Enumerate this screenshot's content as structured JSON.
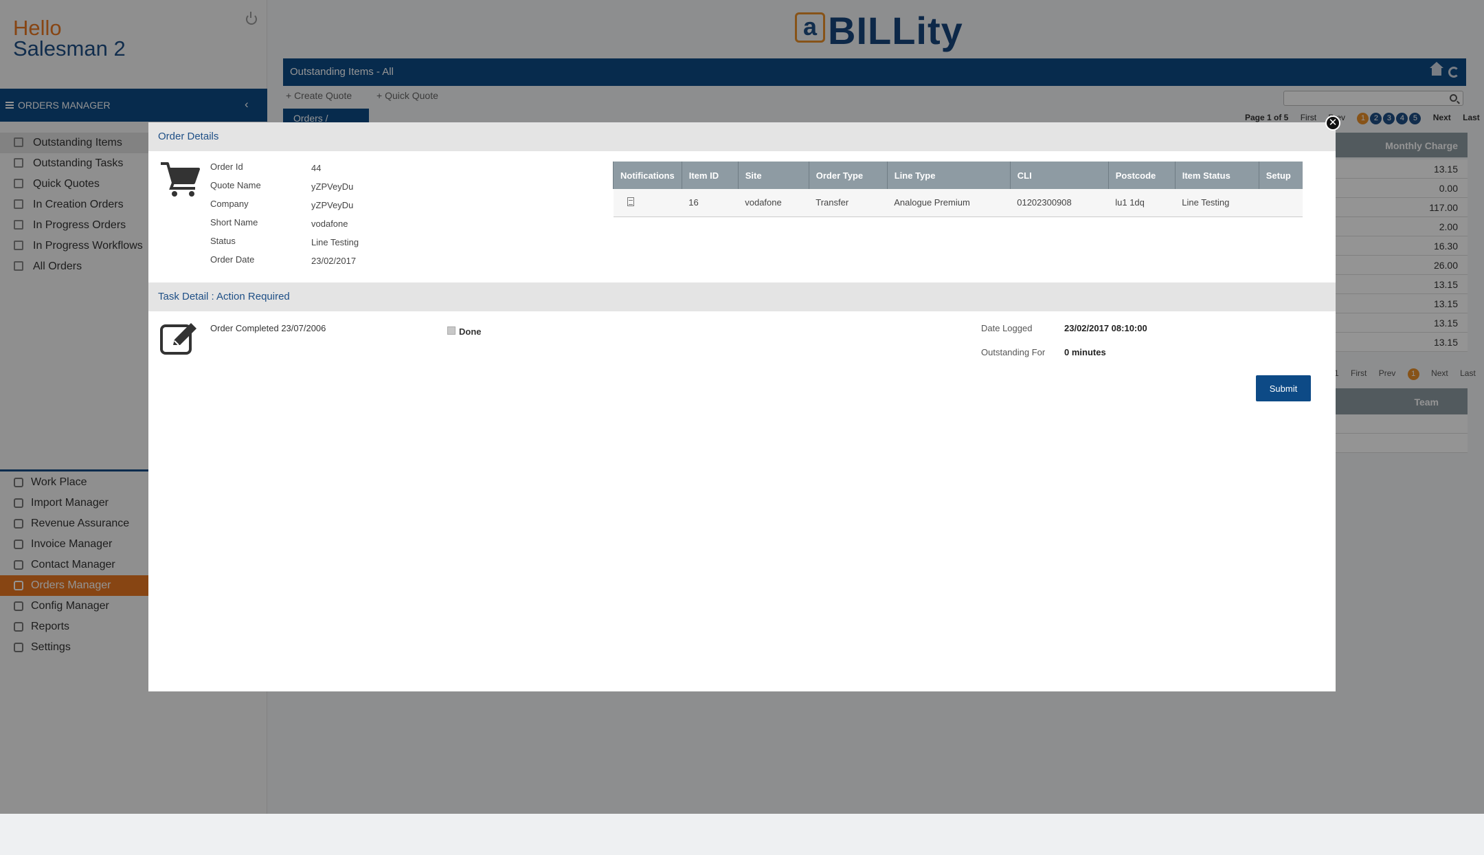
{
  "greeting": {
    "line1": "Hello",
    "line2": "Salesman 2"
  },
  "sidebar": {
    "header": "ORDERS MANAGER",
    "sub_items": [
      {
        "label": "Outstanding Items",
        "icon": "eye-icon"
      },
      {
        "label": "Outstanding Tasks",
        "icon": "clipboard-icon"
      },
      {
        "label": "Quick Quotes",
        "icon": "quote-icon"
      },
      {
        "label": "In Creation Orders",
        "icon": "gear-icon"
      },
      {
        "label": "In Progress Orders",
        "icon": "gear-icon"
      },
      {
        "label": "In Progress Workflows",
        "icon": "workflow-icon"
      },
      {
        "label": "All Orders",
        "icon": "orders-icon"
      }
    ],
    "nav_items": [
      {
        "label": "Work Place",
        "icon": "edit-icon"
      },
      {
        "label": "Import Manager",
        "icon": "import-icon"
      },
      {
        "label": "Revenue Assurance",
        "icon": "chart-icon"
      },
      {
        "label": "Invoice Manager",
        "icon": "monitor-icon"
      },
      {
        "label": "Contact Manager",
        "icon": "user-icon"
      },
      {
        "label": "Orders Manager",
        "icon": "cart-icon"
      },
      {
        "label": "Config Manager",
        "icon": "tools-icon"
      },
      {
        "label": "Reports",
        "icon": "reports-icon"
      },
      {
        "label": "Settings",
        "icon": "gear-icon"
      }
    ]
  },
  "logo": {
    "a": "a",
    "rest": "BILLity"
  },
  "topbar": {
    "title": "Outstanding Items - All"
  },
  "actions": {
    "create_quote": "+ Create Quote",
    "quick_quote": "+ Quick Quote"
  },
  "tab": {
    "orders_quotes": "Orders / Quotes"
  },
  "pager": {
    "page_info": "Page 1 of 5",
    "first": "First",
    "prev": "Prev",
    "pages": [
      "1",
      "2",
      "3",
      "4",
      "5"
    ],
    "next": "Next",
    "last": "Last"
  },
  "monthly": {
    "header": "Monthly Charge",
    "values": [
      "13.15",
      "0.00",
      "117.00",
      "2.00",
      "16.30",
      "26.00",
      "13.15",
      "13.15",
      "13.15",
      "13.15"
    ]
  },
  "pager2": {
    "num": "1",
    "first": "First",
    "prev": "Prev",
    "page": "1",
    "next": "Next",
    "last": "Last"
  },
  "team": {
    "header": "Team"
  },
  "modal": {
    "order_details_title": "Order Details",
    "fields": [
      {
        "label": "Order Id",
        "value": "44"
      },
      {
        "label": "Quote Name",
        "value": "yZPVeyDu"
      },
      {
        "label": "Company",
        "value": "yZPVeyDu"
      },
      {
        "label": "Short Name",
        "value": "vodafone"
      },
      {
        "label": "Status",
        "value": "Line Testing"
      },
      {
        "label": "Order Date",
        "value": "23/02/2017"
      }
    ],
    "table": {
      "columns": [
        "Notifications",
        "Item ID",
        "Site",
        "Order Type",
        "Line Type",
        "CLI",
        "Postcode",
        "Item Status",
        "Setup"
      ],
      "rows": [
        {
          "item_id": "16",
          "site": "vodafone",
          "order_type": "Transfer",
          "line_type": "Analogue Premium",
          "cli": "01202300908",
          "postcode": "lu1 1dq",
          "item_status": "Line Testing",
          "setup": ""
        }
      ]
    },
    "task_title": "Task Detail : Action Required",
    "task_text": "Order Completed 23/07/2006",
    "done_label": "Done",
    "date_logged_label": "Date Logged",
    "date_logged_value": "23/02/2017 08:10:00",
    "outstanding_label": "Outstanding For",
    "outstanding_value": "0 minutes",
    "submit": "Submit"
  },
  "colors": {
    "brand_blue": "#0d4a86",
    "accent_orange": "#e87722",
    "table_header": "#8e9ba3"
  }
}
